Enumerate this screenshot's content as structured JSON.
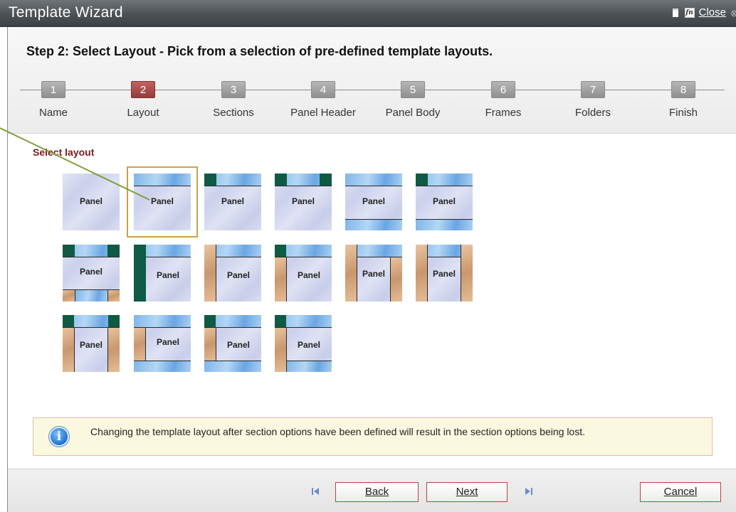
{
  "window": {
    "title": "Template Wizard",
    "close_label": "Close"
  },
  "header": {
    "step_title": "Step 2: Select Layout - Pick from a selection of pre-defined template layouts."
  },
  "steps": [
    {
      "num": "1",
      "label": "Name"
    },
    {
      "num": "2",
      "label": "Layout",
      "active": true
    },
    {
      "num": "3",
      "label": "Sections"
    },
    {
      "num": "4",
      "label": "Panel Header"
    },
    {
      "num": "5",
      "label": "Panel Body"
    },
    {
      "num": "6",
      "label": "Frames"
    },
    {
      "num": "7",
      "label": "Folders"
    },
    {
      "num": "8",
      "label": "Finish"
    }
  ],
  "content": {
    "select_label": "Select layout",
    "panel_text": "Panel",
    "selected_layout_index": 1
  },
  "info": {
    "message": "Changing the template layout after section options have been defined will result in the section options being lost."
  },
  "footer": {
    "back": "Back",
    "next": "Next",
    "cancel": "Cancel"
  },
  "colors": {
    "accent": "#943c3a",
    "header_blue": "#7fb6ea",
    "frame_green": "#0f5a44",
    "side_tan": "#c9976d",
    "info_bg": "#fbf8e0"
  }
}
